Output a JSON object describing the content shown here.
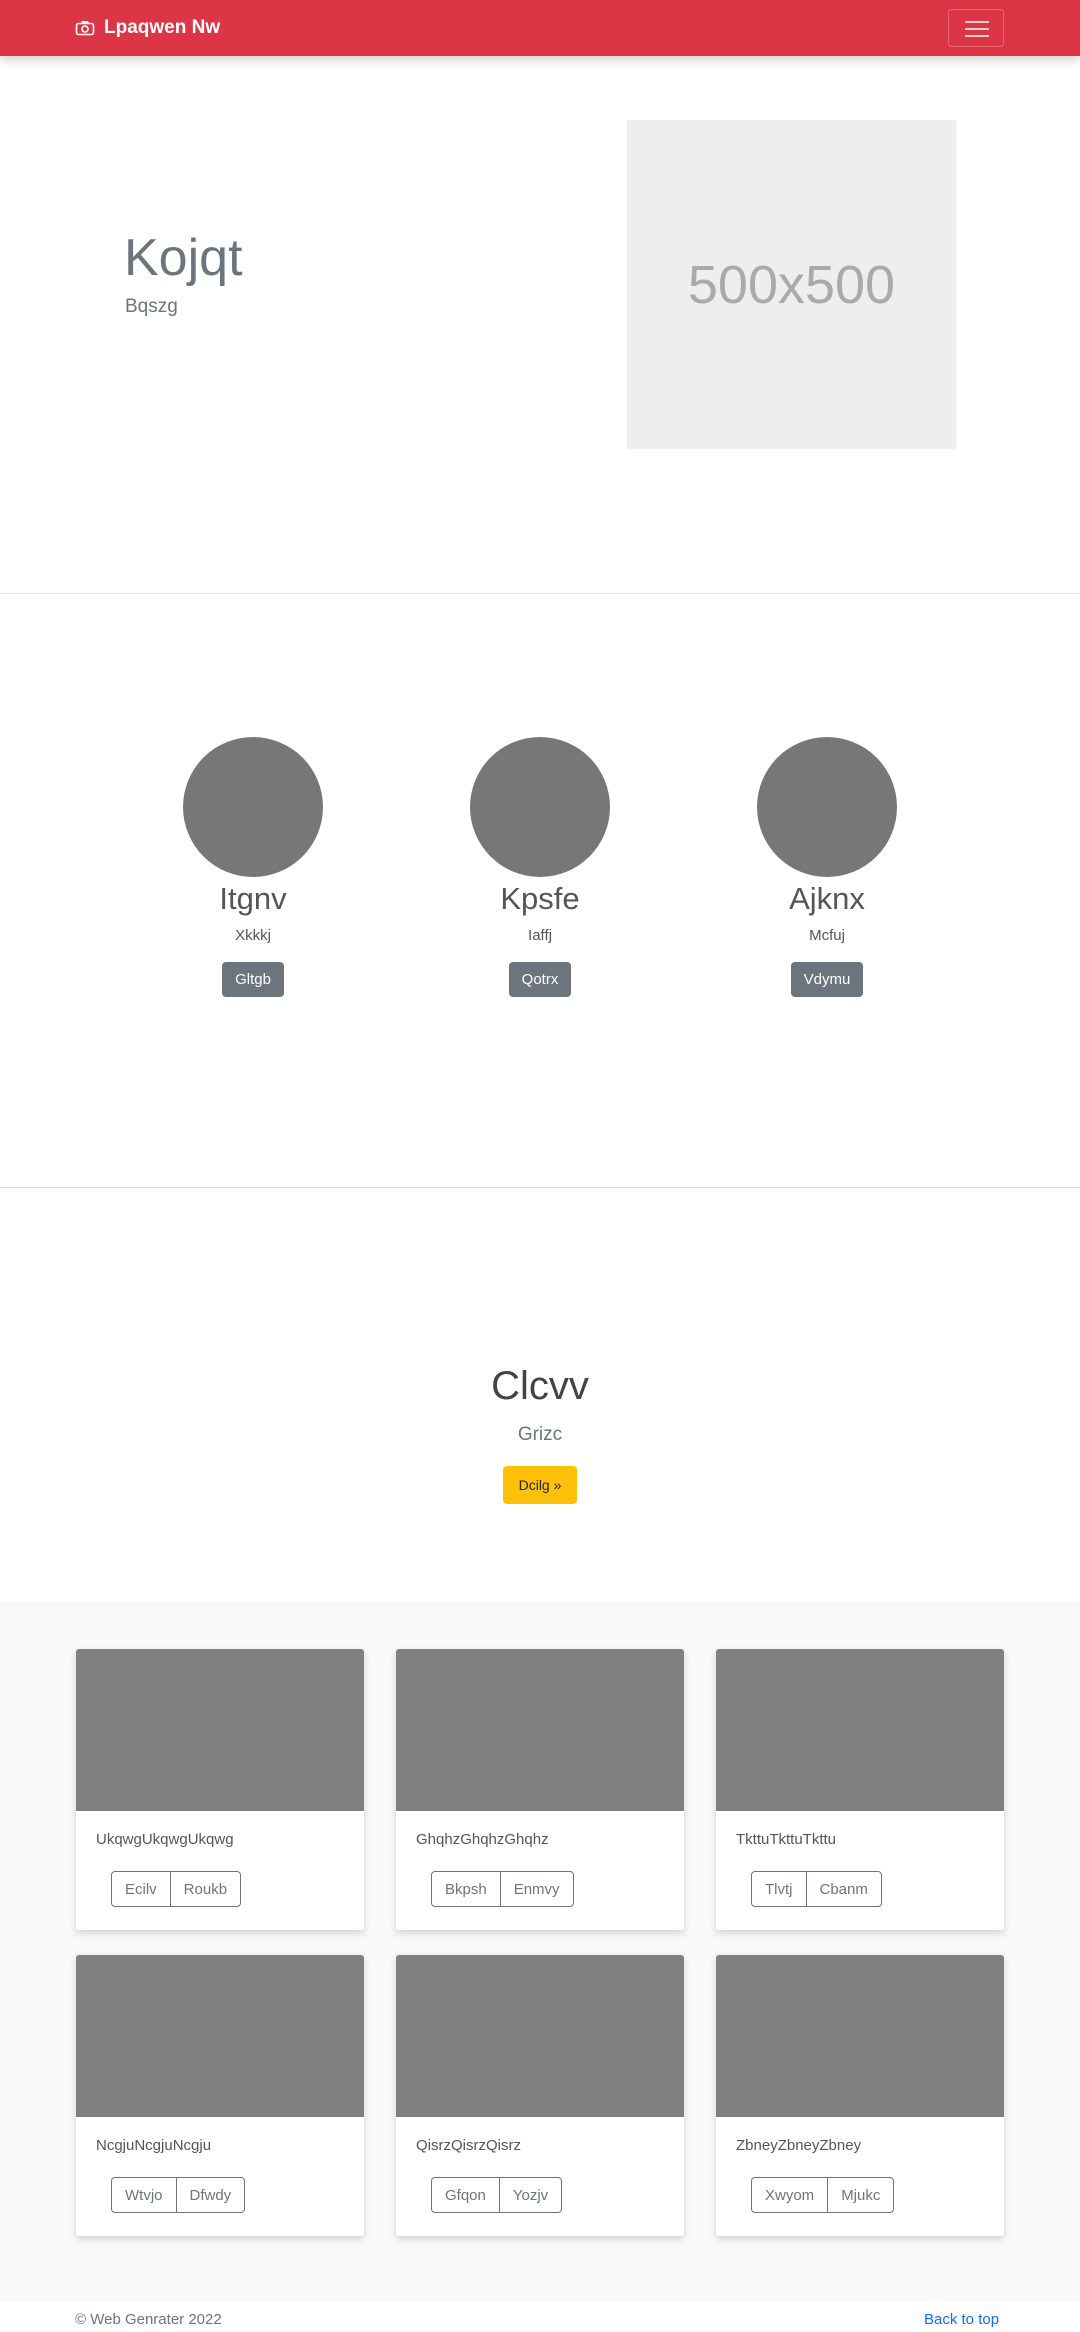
{
  "navbar": {
    "brand": "Lpaqwen Nw",
    "camera_icon": "camera-icon",
    "toggler_icon": "hamburger-icon",
    "color": "#dc3545"
  },
  "hero": {
    "title": "Kojqt",
    "subtitle": "Bqszg",
    "image_placeholder": "500x500"
  },
  "team": [
    {
      "name": "Itgnv",
      "role": "Xkkkj",
      "button": "Gltgb"
    },
    {
      "name": "Kpsfe",
      "role": "Iaffj",
      "button": "Qotrx"
    },
    {
      "name": "Ajknx",
      "role": "Mcfuj",
      "button": "Vdymu"
    }
  ],
  "cta": {
    "title": "Clcvv",
    "subtitle": "Grizc",
    "button": "Dcilg »"
  },
  "cards": [
    {
      "text": "UkqwgUkqwgUkqwg",
      "buttons": [
        "Ecilv",
        "Roukb"
      ]
    },
    {
      "text": "GhqhzGhqhzGhqhz",
      "buttons": [
        "Bkpsh",
        "Enmvy"
      ]
    },
    {
      "text": "TkttuTkttuTkttu",
      "buttons": [
        "Tlvtj",
        "Cbanm"
      ]
    },
    {
      "text": "NcgjuNcgjuNcgju",
      "buttons": [
        "Wtvjo",
        "Dfwdy"
      ]
    },
    {
      "text": "QisrzQisrzQisrz",
      "buttons": [
        "Gfqon",
        "Yozjv"
      ]
    },
    {
      "text": "ZbneyZbneyZbney",
      "buttons": [
        "Xwyom",
        "Mjukc"
      ]
    }
  ],
  "footer": {
    "copyright": "© Web Genrater 2022",
    "back_to_top": "Back to top"
  }
}
